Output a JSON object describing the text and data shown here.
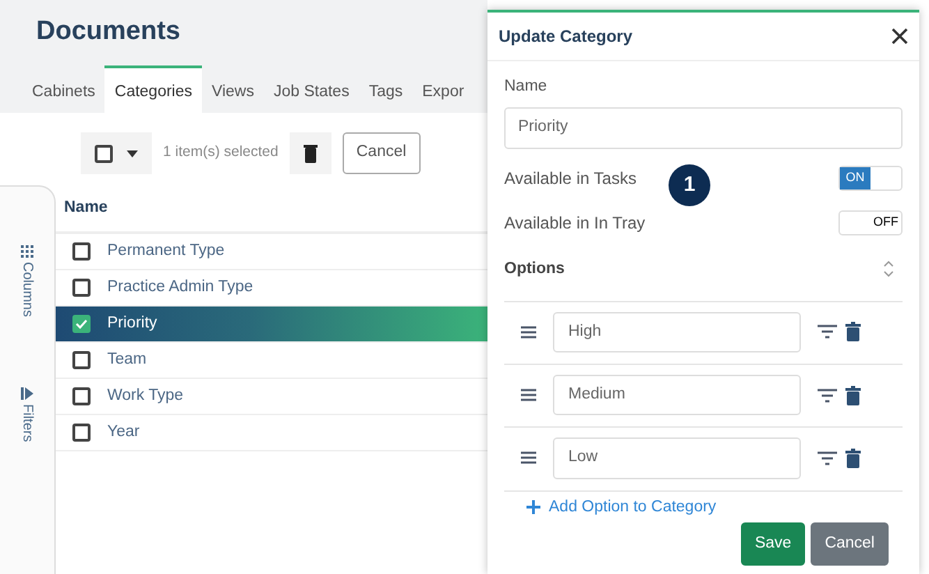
{
  "page": {
    "title": "Documents"
  },
  "tabs": [
    {
      "label": "Cabinets",
      "selected": false
    },
    {
      "label": "Categories",
      "selected": true
    },
    {
      "label": "Views",
      "selected": false
    },
    {
      "label": "Job States",
      "selected": false
    },
    {
      "label": "Tags",
      "selected": false
    },
    {
      "label": "Expor",
      "selected": false
    }
  ],
  "toolbar": {
    "selected_count": "1 item(s) selected",
    "cancel": "Cancel"
  },
  "side_tabs": [
    "Columns",
    "Filters"
  ],
  "table": {
    "column": "Name",
    "rows": [
      {
        "name": "Permanent Type",
        "checked": false
      },
      {
        "name": "Practice Admin Type",
        "checked": false
      },
      {
        "name": "Priority",
        "checked": true
      },
      {
        "name": "Team",
        "checked": false
      },
      {
        "name": "Work Type",
        "checked": false
      },
      {
        "name": "Year",
        "checked": false
      }
    ]
  },
  "panel": {
    "title": "Update Category",
    "name_label": "Name",
    "name_value": "Priority",
    "toggles": [
      {
        "label": "Available in Tasks",
        "on": true,
        "text": "ON"
      },
      {
        "label": "Available in In Tray",
        "on": false,
        "text": "OFF"
      }
    ],
    "options_heading": "Options",
    "options": [
      {
        "value": "High"
      },
      {
        "value": "Medium"
      },
      {
        "value": "Low"
      }
    ],
    "add_link": "Add Option to Category",
    "buttons": [
      {
        "label": "Save",
        "kind": "primary"
      },
      {
        "label": "Cancel",
        "kind": "secondary"
      }
    ]
  },
  "callout": "1"
}
